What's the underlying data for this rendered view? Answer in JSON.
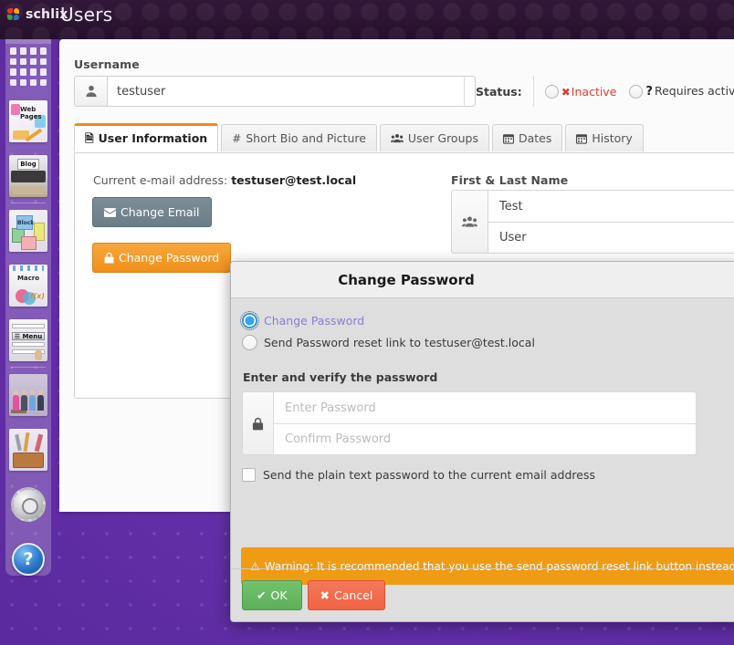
{
  "header": {
    "brand": "schlix",
    "brand_icon": "pinwheel-logo-icon",
    "page_title": "Users"
  },
  "sidebar": {
    "items": [
      {
        "label": "Dashboard",
        "icon": "grid-icon"
      },
      {
        "label": "Web Pages",
        "icon": "web-pages-icon"
      },
      {
        "label": "Blog",
        "icon": "blog-typewriter-icon"
      },
      {
        "label": "Block",
        "icon": "block-boxes-icon"
      },
      {
        "label": "Macro",
        "icon": "macro-icon"
      },
      {
        "label": "Menu",
        "icon": "menu-icon"
      },
      {
        "label": "Users",
        "icon": "users-photo-icon"
      },
      {
        "label": "Tools",
        "icon": "toolbox-icon"
      },
      {
        "label": "Settings",
        "icon": "gear-icon"
      },
      {
        "label": "Help",
        "icon": "help-question-icon"
      }
    ]
  },
  "form": {
    "username_label": "Username",
    "username_value": "testuser",
    "username_icon": "user-icon",
    "status_label": "Status:",
    "status_options": [
      {
        "label": "Inactive",
        "glyph": "x-icon",
        "color": "#d9422e",
        "selected": false
      },
      {
        "label": "Requires activation",
        "glyph": "question-icon",
        "color": "#222222",
        "selected": false
      }
    ]
  },
  "tabs": [
    {
      "label": "User Information",
      "icon": "file-icon",
      "glyph": "὜E",
      "active": true
    },
    {
      "label": "Short Bio and Picture",
      "icon": "hash-icon",
      "glyph": "#",
      "active": false
    },
    {
      "label": "User Groups",
      "icon": "users-icon",
      "glyph": "⚇",
      "active": false
    },
    {
      "label": "Dates",
      "icon": "calendar-icon",
      "glyph": "Ὄ5",
      "active": false
    },
    {
      "label": "History",
      "icon": "calendar-icon",
      "glyph": "Ὄ5",
      "active": false
    }
  ],
  "user_info": {
    "email_prefix": "Current e-mail address:",
    "email_value": "testuser@test.local",
    "change_email_button": "Change Email",
    "change_email_icon": "envelope-icon",
    "change_password_button": "Change Password",
    "change_password_icon": "lock-icon",
    "names_label": "First & Last Name",
    "names_icon": "users-icon",
    "first_name": "Test",
    "last_name": "User"
  },
  "modal": {
    "title": "Change Password",
    "options": [
      {
        "label": "Change Password",
        "selected": true
      },
      {
        "label": "Send Password reset link to testuser@test.local",
        "selected": false
      }
    ],
    "section_label": "Enter and verify the password",
    "lock_icon": "lock-icon",
    "password_placeholder": "Enter Password",
    "password_value": "",
    "confirm_placeholder": "Confirm Password",
    "confirm_value": "",
    "plain_text_checkbox_label": "Send the plain text password to the current email address",
    "plain_text_checked": false,
    "warning_icon": "warning-triangle-icon",
    "warning_text": "Warning: It is recommended that you use the send password reset link button instead of emailing plai",
    "warning_color": "#ef9b13",
    "ok_button": "OK",
    "ok_icon": "check-icon",
    "cancel_button": "Cancel",
    "cancel_icon": "x-icon"
  },
  "theme": {
    "accent_orange": "#f0891e",
    "header_purple": "#2d1534",
    "background_purple": "#6b35b5",
    "danger_red": "#d9422e",
    "success_green": "#5cb05a"
  }
}
